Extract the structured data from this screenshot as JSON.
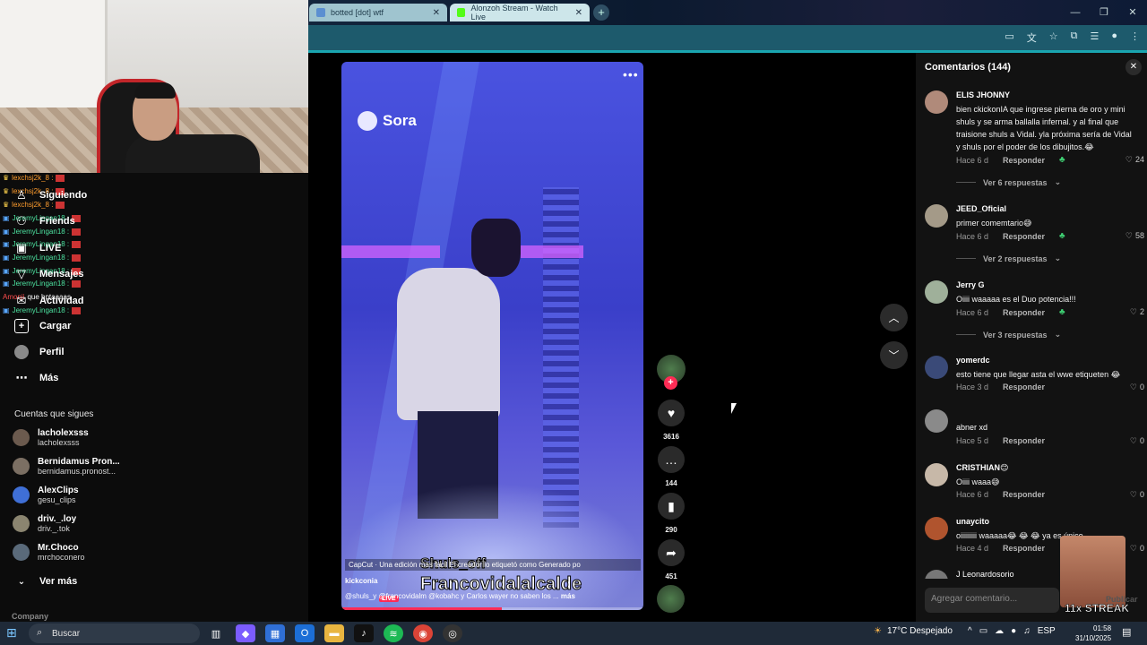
{
  "browser": {
    "tabs": [
      {
        "title": "botted [dot] wtf",
        "fav_color": "#5b8fd1"
      },
      {
        "title": "Alonzoh Stream - Watch Live",
        "fav_color": "#53fc18"
      }
    ],
    "new_tab_label": "+"
  },
  "chat_overlay": [
    {
      "user": "lexchsj2k_8 :",
      "color": "#ff9d2e"
    },
    {
      "user": "lexchsj2k_8 :",
      "color": "#ff9d2e"
    },
    {
      "user": "lexchsj2k_8 :",
      "color": "#ff9d2e"
    },
    {
      "user": "JeremyLingan18 :",
      "color": "#4de3a1"
    },
    {
      "user": "JeremyLingan18 :",
      "color": "#4de3a1"
    },
    {
      "user": "JeremyLingan18 :",
      "color": "#4de3a1"
    },
    {
      "user": "JeremyLingan18 :",
      "color": "#4de3a1"
    },
    {
      "user": "JeremyLingan18 :",
      "color": "#4de3a1"
    },
    {
      "user": "JeremyLingan18 :",
      "color": "#4de3a1"
    },
    {
      "user": "JeremyLingan18 :",
      "color": "#4de3a1"
    }
  ],
  "chat_overlay_message": {
    "user": "Amonii",
    "text": "que hptaaaas"
  },
  "sidebar": {
    "nav": [
      {
        "label": "Siguiendo",
        "icon": "following-icon"
      },
      {
        "label": "Friends",
        "icon": "friends-icon"
      },
      {
        "label": "LIVE",
        "icon": "live-icon"
      },
      {
        "label": "Mensajes",
        "icon": "messages-icon"
      },
      {
        "label": "Actividad",
        "icon": "activity-icon"
      },
      {
        "label": "Cargar",
        "icon": "upload-icon"
      },
      {
        "label": "Perfil",
        "icon": "profile-icon"
      },
      {
        "label": "Más",
        "icon": "more-icon"
      }
    ],
    "following_title": "Cuentas que sigues",
    "accounts": [
      {
        "name": "lacholexsss",
        "handle": "lacholexsss"
      },
      {
        "name": "Bernidamus Pron...",
        "handle": "bernidamus.pronost..."
      },
      {
        "name": "AlexClips",
        "handle": "gesu_clips"
      },
      {
        "name": "driv._.loy",
        "handle": "driv._.tok"
      },
      {
        "name": "Mr.Choco",
        "handle": "mrchoconero"
      }
    ],
    "see_more": "Ver más",
    "company": "Company"
  },
  "video": {
    "watermark": "Sora",
    "menu_label": "•••",
    "overlay_subtitle": "Shuls_off",
    "overlay_title": "Francovidalalcalde",
    "notice": "CapCut · Una edición más fácil   El creador lo etiquetó como Generado po",
    "author": "kickconia",
    "live_label": "LIVE",
    "description": "@shuls_y  @francovidalm  @kobahc y Carlos wayer no saben los ...",
    "more": "más",
    "progress": 0.53
  },
  "actions": {
    "likes": "3616",
    "comments": "144",
    "saves": "290",
    "shares": "451"
  },
  "comments": {
    "header": "Comentarios (144)",
    "items": [
      {
        "name": "ELIS JHONNY",
        "text": "bien ckickonIA que ingrese pierna de oro y mini shuls y se arma ballalla infernal. y al final que traisione shuls a Vidal. yla próxima sería de Vidal y shuls por el poder de los dibujitos.😂",
        "time": "Hace 6 d",
        "reply": "Responder",
        "likes": "24",
        "replies": "Ver 6 respuestas"
      },
      {
        "name": "JEED_Oficial",
        "text": "primer comemtario😅",
        "time": "Hace 6 d",
        "reply": "Responder",
        "likes": "58",
        "replies": "Ver 2 respuestas"
      },
      {
        "name": "Jerry G",
        "text": "Oiiii waaaaa es el Duo potencia!!!",
        "time": "Hace 6 d",
        "reply": "Responder",
        "likes": "2",
        "replies": "Ver 3 respuestas"
      },
      {
        "name": "yomerdc",
        "text": "esto tiene que llegar asta el wwe etiqueten 😂",
        "time": "Hace 3 d",
        "reply": "Responder",
        "likes": "0"
      },
      {
        "name": "abner xd",
        "text": "",
        "time": "Hace 5 d",
        "reply": "Responder",
        "likes": "0"
      },
      {
        "name": "CRISTHIAN😊",
        "text": "Oiiii waaa😅",
        "time": "Hace 6 d",
        "reply": "Responder",
        "likes": "0"
      },
      {
        "name": "unaycito",
        "text": "oiiiiiiiii waaaaa😂 😂 😂  ya es único",
        "time": "Hace 4 d",
        "reply": "Responder",
        "likes": "0"
      },
      {
        "name": "J Leonardosorio",
        "text": "",
        "time": "",
        "reply": "",
        "likes": ""
      }
    ],
    "input_placeholder": "Agregar comentario...",
    "publish": "Publicar",
    "streak": "11x STREAK"
  },
  "taskbar": {
    "search": "Buscar",
    "weather": "17°C  Despejado",
    "lang": "ESP",
    "time": "01:58",
    "date": "31/10/2025"
  }
}
